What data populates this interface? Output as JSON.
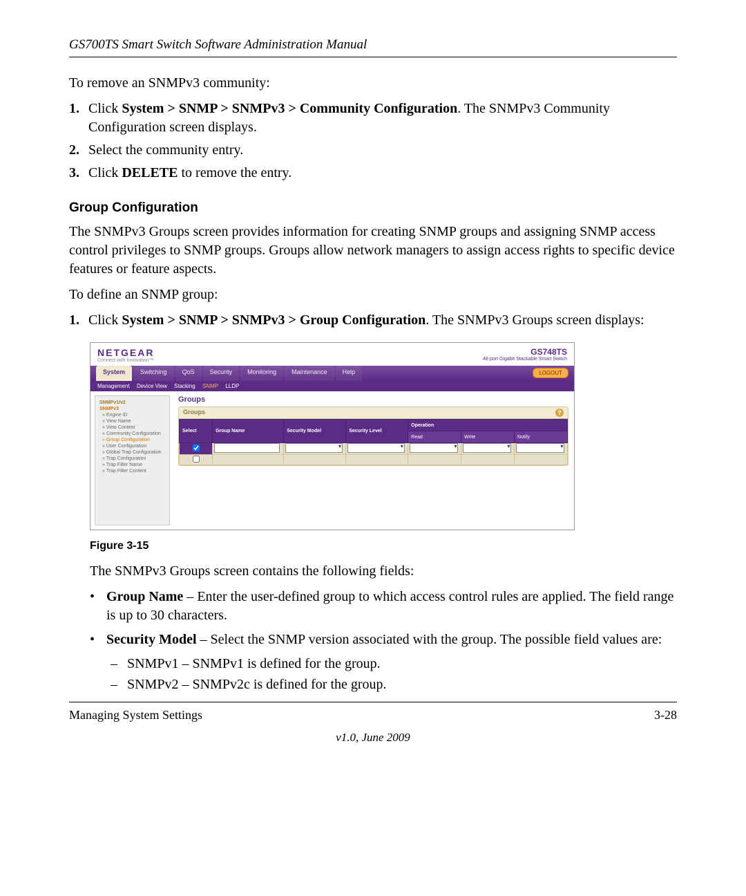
{
  "header": "GS700TS Smart Switch Software Administration Manual",
  "intro1": "To remove an SNMPv3 community:",
  "steps_remove": [
    {
      "n": "1.",
      "pre": "Click ",
      "bold": "System > SNMP > SNMPv3 > Community Configuration",
      "post": ". The SNMPv3 Community Configuration screen displays."
    },
    {
      "n": "2.",
      "pre": "Select the community entry.",
      "bold": "",
      "post": ""
    },
    {
      "n": "3.",
      "pre": "Click ",
      "bold": "DELETE",
      "post": " to remove the entry."
    }
  ],
  "section": "Group Configuration",
  "section_para": "The SNMPv3 Groups screen provides information for creating SNMP groups and assigning SNMP access control privileges to SNMP groups. Groups allow network managers to assign access rights to specific device features or feature aspects.",
  "intro2": "To define an SNMP group:",
  "steps_define": [
    {
      "n": "1.",
      "pre": "Click ",
      "bold": "System > SNMP > SNMPv3 > Group Configuration",
      "post": ". The SNMPv3 Groups screen displays:"
    }
  ],
  "screenshot": {
    "brand": "NETGEAR",
    "tagline": "Connect with Innovation™",
    "model": "GS748TS",
    "model_sub": "48-port Gigabit Stackable Smart Switch",
    "tabs": [
      "System",
      "Switching",
      "QoS",
      "Security",
      "Monitoring",
      "Maintenance",
      "Help"
    ],
    "active_tab": "System",
    "logout": "LOGOUT",
    "subtabs": [
      "Management",
      "Device View",
      "Stacking",
      "SNMP",
      "LLDP"
    ],
    "subtab_hot": "SNMP",
    "sidebar": {
      "cat1": "SNMPv1/v2",
      "cat2": "SNMPv3",
      "items": [
        "Engine ID",
        "View Name",
        "View Content",
        "Community Configuration",
        "Group Configuration",
        "User Configuration",
        "Global Trap Configuration",
        "Trap Configuration",
        "Trap Filter Name",
        "Trap Filter Content"
      ],
      "hot_item": "Group Configuration"
    },
    "main_title": "Groups",
    "panel_title": "Groups",
    "columns": {
      "select": "Select",
      "group_name": "Group Name",
      "sec_model": "Security Model",
      "sec_level": "Security Level",
      "operation": "Operation",
      "read": "Read",
      "write": "Write",
      "notify": "Notify"
    }
  },
  "figure_caption": "Figure 3-15",
  "after_fig": "The SNMPv3 Groups screen contains the following fields:",
  "fields": [
    {
      "bold": "Group Name",
      "text": " – Enter the user-defined group to which access control rules are applied. The field range is up to 30 characters."
    },
    {
      "bold": "Security Model",
      "text": " – Select the SNMP version associated with the group. The possible field values are:",
      "subs": [
        "SNMPv1 – SNMPv1 is defined for the group.",
        "SNMPv2 – SNMPv2c is defined for the group."
      ]
    }
  ],
  "footer_left": "Managing System Settings",
  "footer_right": "3-28",
  "footer_center": "v1.0, June 2009"
}
